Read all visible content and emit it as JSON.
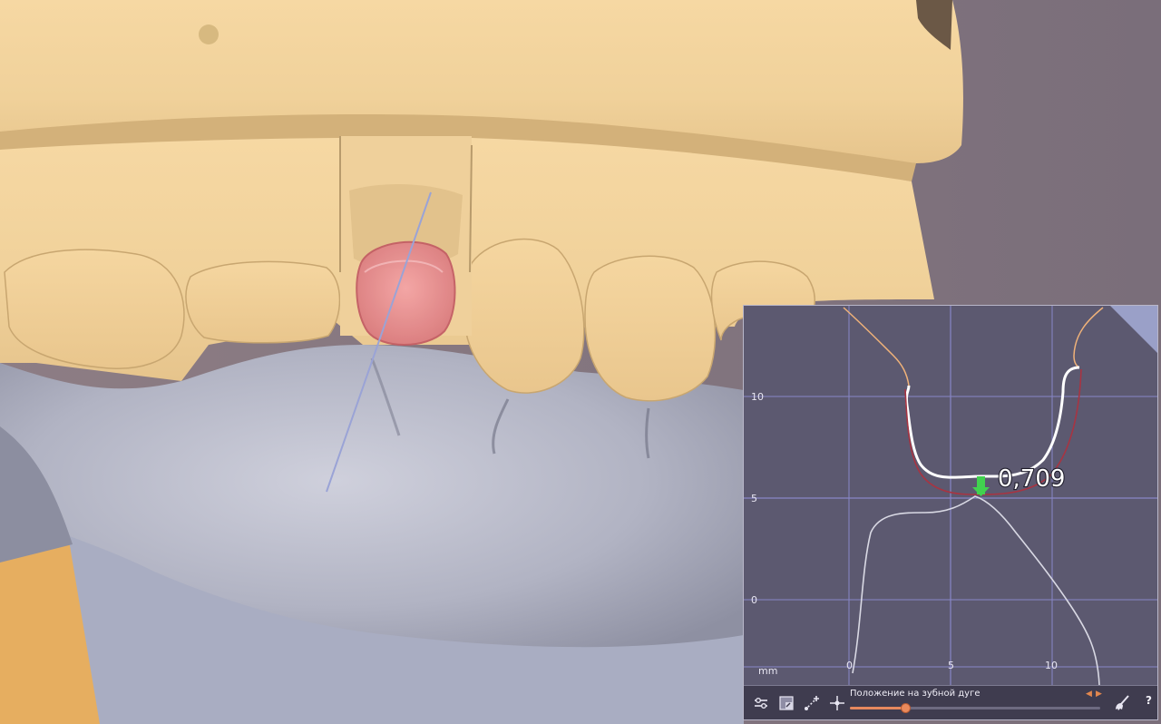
{
  "viewport": {
    "title": "",
    "colors": {
      "background": "#8a7f86",
      "upper_model": "#f2d49e",
      "lower_model": "#b4b6c4",
      "restoration": "#e88a8c",
      "base_plate": "#e8b266",
      "axis_line": "#9aa3d6"
    }
  },
  "section_panel": {
    "measurement": "0,709",
    "unit_label": "mm",
    "y_ticks": [
      "10",
      "5",
      "0"
    ],
    "x_ticks": [
      "0",
      "5",
      "10"
    ],
    "colors": {
      "background": "#5c5970",
      "grid": "#8886c7",
      "antagonist_contour": "#f0b279",
      "restoration_contour": "#ffffff",
      "offset_contour": "#a83442",
      "lower_contour": "#d9d9e4",
      "contact_marker": "#41d24f"
    },
    "toolbar": {
      "buttons": [
        {
          "icon": "sliders-icon"
        },
        {
          "icon": "view-cube-icon"
        },
        {
          "icon": "add-point-icon"
        },
        {
          "icon": "move-point-icon"
        },
        {
          "icon": "brush-icon"
        }
      ],
      "slider_label": "Положение на зубной дуге",
      "slider_value": 0.22,
      "help_label": "?"
    }
  }
}
